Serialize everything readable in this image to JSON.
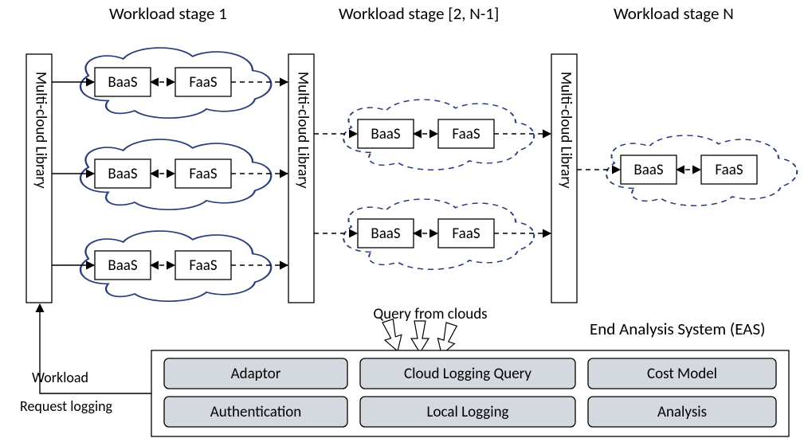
{
  "headings": {
    "stage1": "Workload stage 1",
    "stage2": "Workload stage [2, N-1]",
    "stageN": "Workload stage N"
  },
  "vlabel": "Multi-cloud Library",
  "node": {
    "baas": "BaaS",
    "faas": "FaaS"
  },
  "query_label": "Query from clouds",
  "eas": {
    "title": "End Analysis System (EAS)",
    "adaptor": "Adaptor",
    "cloud_logging_query": "Cloud Logging Query",
    "cost_model": "Cost Model",
    "authentication": "Authentication",
    "local_logging": "Local Logging",
    "analysis": "Analysis"
  },
  "left": {
    "workload": "Workload",
    "request_logging": "Request logging"
  }
}
